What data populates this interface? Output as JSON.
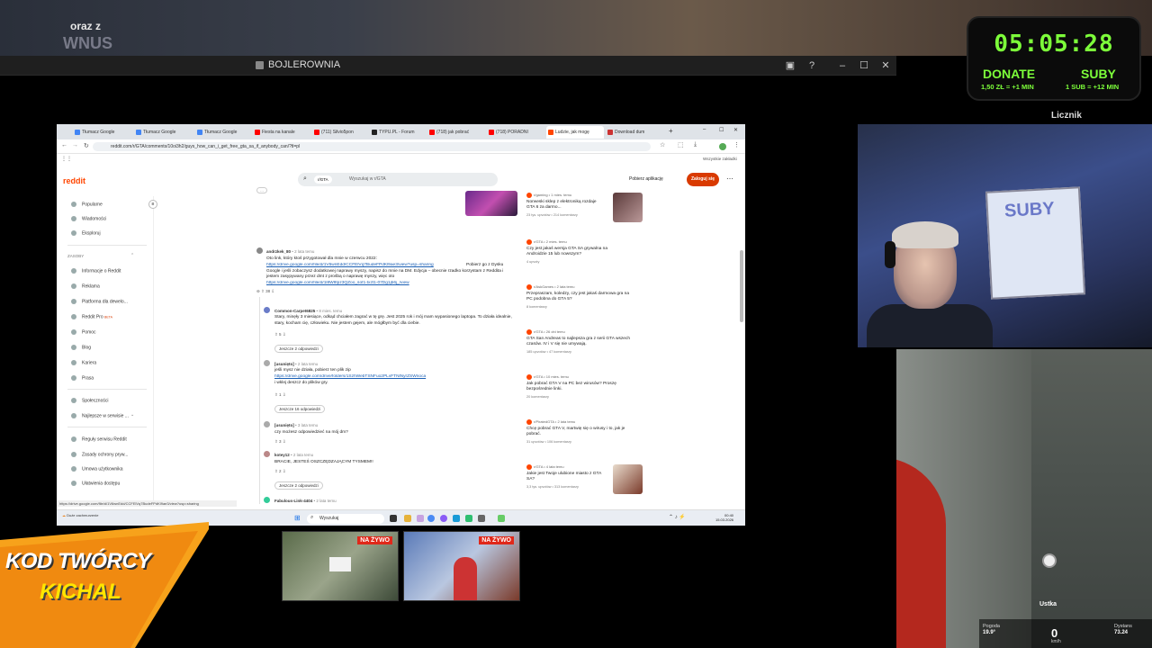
{
  "stream_top": {
    "text_line1": "oraz z",
    "text_line2": "WNUS"
  },
  "window": {
    "title": "BOJLEROWNIA"
  },
  "browser": {
    "tabs": [
      {
        "label": "Tłumacz Google",
        "color": "#4285f4"
      },
      {
        "label": "Tłumacz Google",
        "color": "#4285f4"
      },
      {
        "label": "Tłumacz Google",
        "color": "#4285f4"
      },
      {
        "label": "Fiesta na kanale",
        "color": "#ff0000"
      },
      {
        "label": "(711) Silvio5pon",
        "color": "#ff0000"
      },
      {
        "label": "TYPU.PL - Forum",
        "color": "#222222"
      },
      {
        "label": "(718) jak pobrać",
        "color": "#ff0000"
      },
      {
        "label": "(718) PORADNI",
        "color": "#ff0000"
      },
      {
        "label": "Ludzie, jak mogę",
        "color": "#ff4500"
      },
      {
        "label": "Download dum",
        "color": "#cc3333"
      }
    ],
    "url": "reddit.com/r/GTA/comments/10oi3h2/guys_how_can_i_get_free_gta_sa_if_anybody_can/?tl=pl",
    "bookmarks_right": "Wszystkie zakładki"
  },
  "reddit": {
    "logo": "reddit",
    "search_chip": "r/GTA",
    "search_placeholder": "Wyszukaj w r/GTA",
    "get_app": "Pobierz aplikację",
    "login": "Zaloguj się",
    "nav": [
      "Popularne",
      "Wiadomości",
      "Eksploruj"
    ],
    "section_label": "ZASOBY",
    "resources": [
      "Informacje o Reddit",
      "Reklama",
      "Platforma dla dewelo...",
      "Reddit Pro",
      "Pomoc",
      "Blog",
      "Kariera",
      "Prasa"
    ],
    "reddit_pro_badge": "BETA",
    "community": [
      "Społeczności",
      "Najlepsze w serwisie ...",
      "Reguły serwisu Reddit",
      "Zasady ochrony pryw...",
      "Umowa użytkownika",
      "Ułatwienia dostępu"
    ],
    "comments": [
      {
        "author": "andrzkek_80",
        "meta": "• 2 lata temu",
        "text_1": "Oto link, który ktoś przygotował dla mnie w czerwcu 2022:",
        "link_1": "https://drive.google.com/file/d/1V6wnEdd/CCFElVq7BudeFPdKl9ae3/view?usp=sharing",
        "text_2": "Pobierz go z Dysku Google i jeśli zobaczysz dodatkowej naprawy myszy, napisz do mnie na DM. Edycja – obecnie rzadko korzystam z Reddita i jestem zasypywany przez dmt z prośbą o naprawę myszy, więc oto",
        "link_2": "https://drive.google.com/file/d/1l8W8tpz3QZoo_sof1-txzt1-07Dg1jb6j_/view",
        "votes": "38"
      },
      {
        "author": "Common-Carpet6825",
        "meta": "• 8 mies. temu",
        "text": "Stary, minęły 3 miesiące, odkąd chciałem zagrać w tę grę. Jest 2025 rok i mój mam wypasionego laptopa. To działa idealnie, stary, kocham cię, człowieku. Nie jestem gejem, ale mógłbym być dla ciebie.",
        "votes": "5",
        "replies": "Jeszcze 2 odpowiedzi"
      },
      {
        "author": "[usunięto]",
        "meta": "• 2 lata temu",
        "text_1": "jeśli mysz nie działa, pobierz ten plik zip",
        "link": "https://drive.google.com/drive/folders/1SzhWebTSNFuo2PLvFTNlNyrZSWnoca",
        "text_2": "i wklej deszcz do plików gry.",
        "votes": "1",
        "replies": "Jeszcze 16 odpowiedzi"
      },
      {
        "author": "[usunięto]",
        "meta": "• 3 lata temu",
        "text": "czy możesz odpowiedzieć na mój dm?",
        "votes": "3"
      },
      {
        "author": "kotey12",
        "meta": "• 2 lata temu",
        "text": "BRACIE, JESTEŚ OSZCZĘDZAJĄCYM TYSMEM!!",
        "votes": "2",
        "replies": "Jeszcze 2 odpowiedzi"
      },
      {
        "author": "Fabulous-Link-4404",
        "meta": "• 2 lata temu"
      }
    ],
    "sidebar_posts": [
      {
        "meta": "r/gaming • 1 mies. temu",
        "title": "Norweski sklep z elektroniką rozdaje GTA 6 za darmo...",
        "stats": "23 tys. upvotów • 214 komentarzy",
        "thumb": true
      },
      {
        "meta": "r/GTA • 2 mies. temu",
        "title": "Czy jest jakaś wersja GTA SA grywalna na Androidzie 15 lub nowszym?",
        "stats": "4 upvoty",
        "thumb": false
      },
      {
        "meta": "r/AskGames • 2 lata temu",
        "title": "Przepraszam, koledzy, czy jest jakaś darmowa gra na PC podobna do GTA 5?",
        "stats": "8 komentarzy",
        "thumb": false
      },
      {
        "meta": "r/GTA • 26 dni temu",
        "title": "GTA San Andreas to najlepsza gra z serii GTA wszech czasów. IV i V się nie umywają.",
        "stats": "185 upvotów • 47 komentarzy",
        "thumb": false
      },
      {
        "meta": "r/GTA • 10 mies. temu",
        "title": "Jak pobrać GTA V na PC bez wirusów? Proszę bezpośrednie linki.",
        "stats": "20 komentarzy",
        "thumb": false
      },
      {
        "meta": "r/PiratedGTA • 2 lata temu",
        "title": "Chcę pobrać GTA V, martwię się o wirusy i to, jak je pobrać.",
        "stats": "31 upvotów • 106 komentarzy",
        "thumb": false
      },
      {
        "meta": "r/GTA • 4 lata temu",
        "title": "Jakie jest Twoje ulubione miasto z GTA SA?",
        "stats": "3,3 tys. upvotów • 313 komentarzy",
        "thumb": true
      }
    ],
    "status_url": "https://drive.google.com/file/d/1V6wnEdd/CCFElVq7BudeFPdKl9ae3/view?usp=sharing"
  },
  "taskbar": {
    "weather": "Duże zachmurzenie",
    "search": "Wyszukaj",
    "time": "00:40",
    "date": "15.03.2026"
  },
  "overlay": {
    "timer": "05:05:28",
    "donate_label": "DONATE",
    "donate_sub": "1,50 ZŁ = +1 MIN",
    "suby_label": "SUBY",
    "suby_sub": "1 SUB = +12 MIN",
    "licznik": "Licznik"
  },
  "webcam": {
    "board_text": "SUBY"
  },
  "game": {
    "pogoda_label": "Pogoda",
    "pogoda_value": "19.9°",
    "speed": "0",
    "speed_unit": "km/h",
    "dystans_label": "Dystans",
    "dystans_value": "73.24",
    "place": "Ustka"
  },
  "live": {
    "badge": "NA ŻYWO"
  },
  "creator_code": {
    "line1": "KOD TWÓRCY",
    "line2": "KICHAL"
  }
}
